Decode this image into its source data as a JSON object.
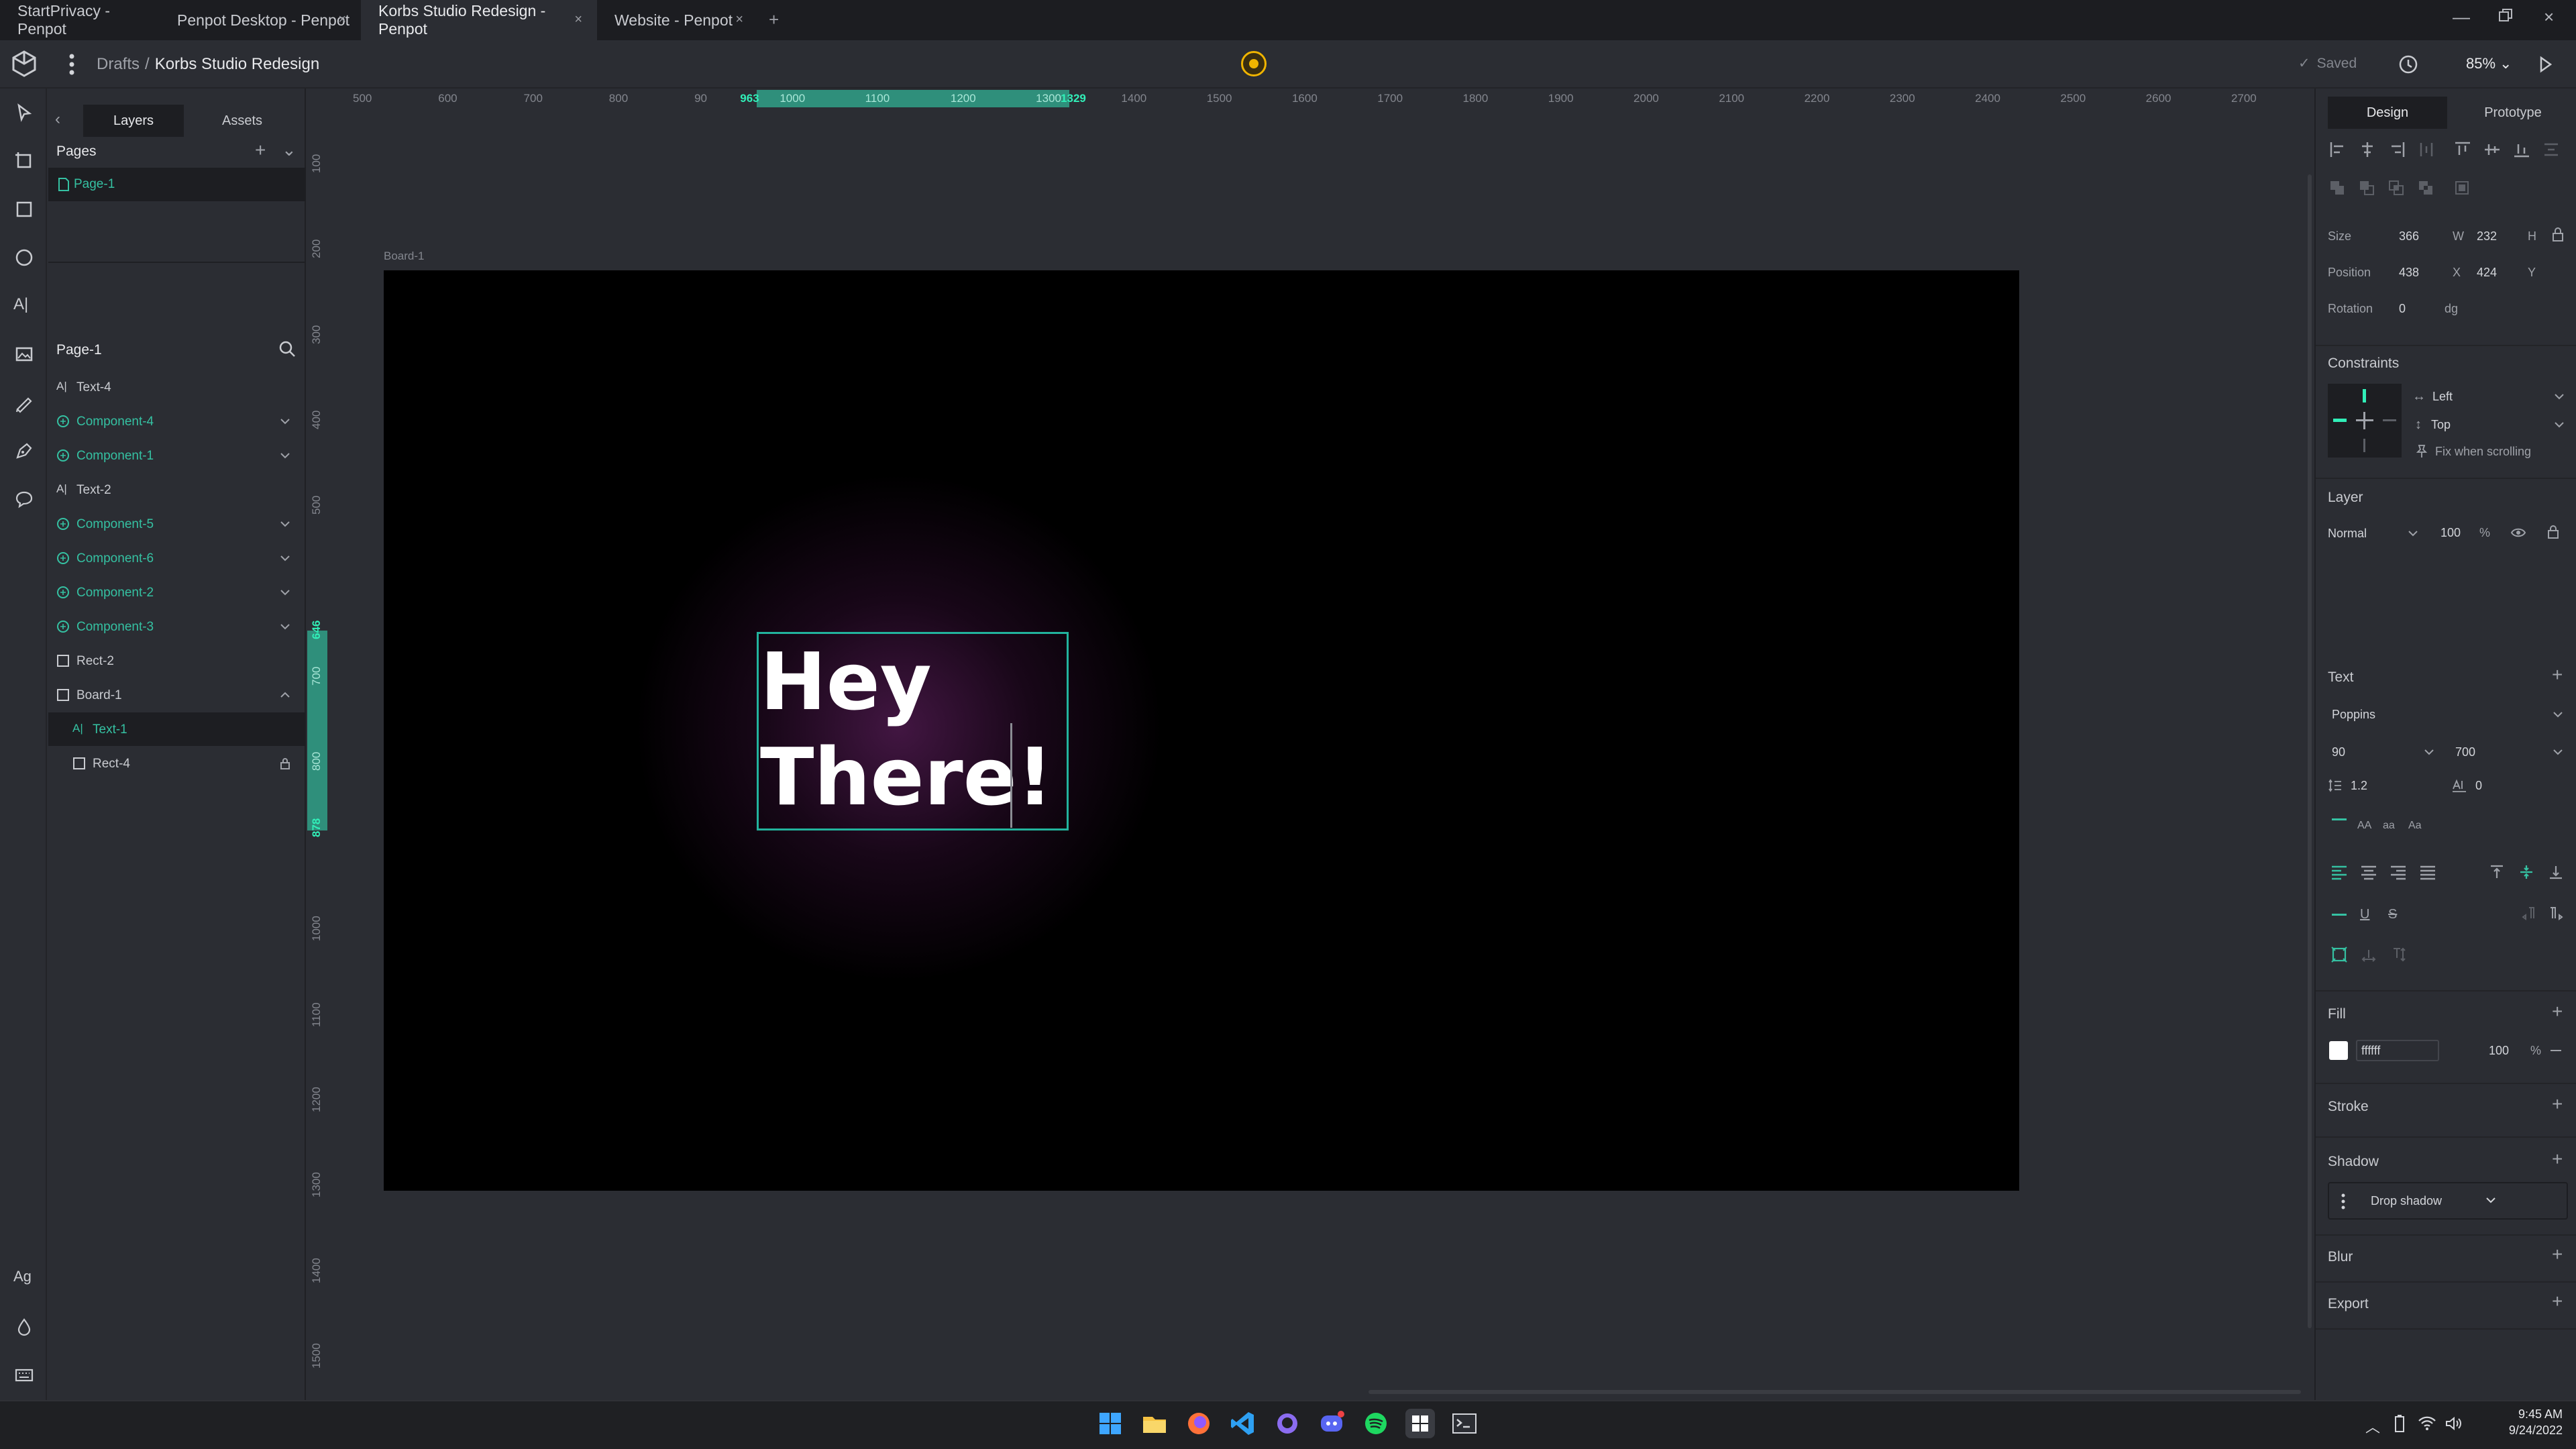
{
  "browser": {
    "tabs": [
      {
        "label": "StartPrivacy - Penpot"
      },
      {
        "label": "Penpot Desktop - Penpot"
      },
      {
        "label": "Korbs Studio Redesign - Penpot"
      },
      {
        "label": "Website - Penpot"
      }
    ],
    "close_glyph": "×",
    "new_tab_glyph": "+"
  },
  "header": {
    "breadcrumb_root": "Drafts",
    "breadcrumb_sep": "/",
    "project_name": "Korbs Studio Redesign",
    "saved_label": "Saved",
    "zoom": "85%"
  },
  "left_panel": {
    "tabs": [
      "Layers",
      "Assets"
    ],
    "pages_title": "Pages",
    "pages": [
      {
        "label": "Page-1"
      }
    ],
    "current_page_title": "Page-1",
    "layers": [
      {
        "label": "Text-4",
        "type": "text"
      },
      {
        "label": "Component-4",
        "type": "component"
      },
      {
        "label": "Component-1",
        "type": "component"
      },
      {
        "label": "Text-2",
        "type": "text"
      },
      {
        "label": "Component-5",
        "type": "component"
      },
      {
        "label": "Component-6",
        "type": "component"
      },
      {
        "label": "Component-2",
        "type": "component"
      },
      {
        "label": "Component-3",
        "type": "component"
      },
      {
        "label": "Rect-2",
        "type": "rect"
      },
      {
        "label": "Board-1",
        "type": "board"
      },
      {
        "label": "Text-1",
        "type": "text",
        "selected": true
      },
      {
        "label": "Rect-4",
        "type": "rect",
        "locked": true
      }
    ]
  },
  "rulers": {
    "horizontal": [
      "500",
      "600",
      "700",
      "800",
      "90",
      "963",
      "1000",
      "1100",
      "1200",
      "1300",
      "1329",
      "1400",
      "1500",
      "1600",
      "1700",
      "1800",
      "1900",
      "2000",
      "2100",
      "2200",
      "2300",
      "2400",
      "2500",
      "2600",
      "2700"
    ],
    "vertical": [
      "100",
      "200",
      "300",
      "400",
      "500",
      "646",
      "700",
      "800",
      "878",
      "1000",
      "1100",
      "1200",
      "1300",
      "1400",
      "1500"
    ]
  },
  "canvas": {
    "board_label": "Board-1",
    "text_content": "Hey\nThere!"
  },
  "right_panel": {
    "tabs": [
      "Design",
      "Prototype"
    ],
    "size": {
      "label": "Size",
      "w": "366",
      "w_unit": "W",
      "h": "232",
      "h_unit": "H"
    },
    "position": {
      "label": "Position",
      "x": "438",
      "x_unit": "X",
      "y": "424",
      "y_unit": "Y"
    },
    "rotation": {
      "label": "Rotation",
      "value": "0",
      "unit": "dg"
    },
    "constraints": {
      "title": "Constraints",
      "horizontal": "Left",
      "vertical": "Top",
      "fix_label": "Fix when scrolling"
    },
    "layer": {
      "title": "Layer",
      "blend": "Normal",
      "opacity": "100",
      "unit": "%"
    },
    "text": {
      "title": "Text",
      "font": "Poppins",
      "size": "90",
      "weight": "700",
      "line_height": "1.2",
      "letter_spacing": "0",
      "case_options": [
        "AA",
        "aa",
        "Aa"
      ]
    },
    "fill": {
      "title": "Fill",
      "hex": "ffffff",
      "opacity": "100",
      "unit": "%"
    },
    "stroke": {
      "title": "Stroke"
    },
    "shadow": {
      "title": "Shadow",
      "type": "Drop shadow"
    },
    "blur": {
      "title": "Blur"
    },
    "export": {
      "title": "Export"
    }
  },
  "taskbar": {
    "time": "9:45 AM",
    "date": "9/24/2022",
    "apps": [
      "windows-start",
      "file-explorer",
      "firefox",
      "vscode",
      "github",
      "discord",
      "spotify",
      "penpot",
      "terminal"
    ]
  },
  "colors": {
    "accent": "#31efb8",
    "selection": "#22b39d",
    "bg_panel": "#2b2d33",
    "board": "#000000"
  }
}
